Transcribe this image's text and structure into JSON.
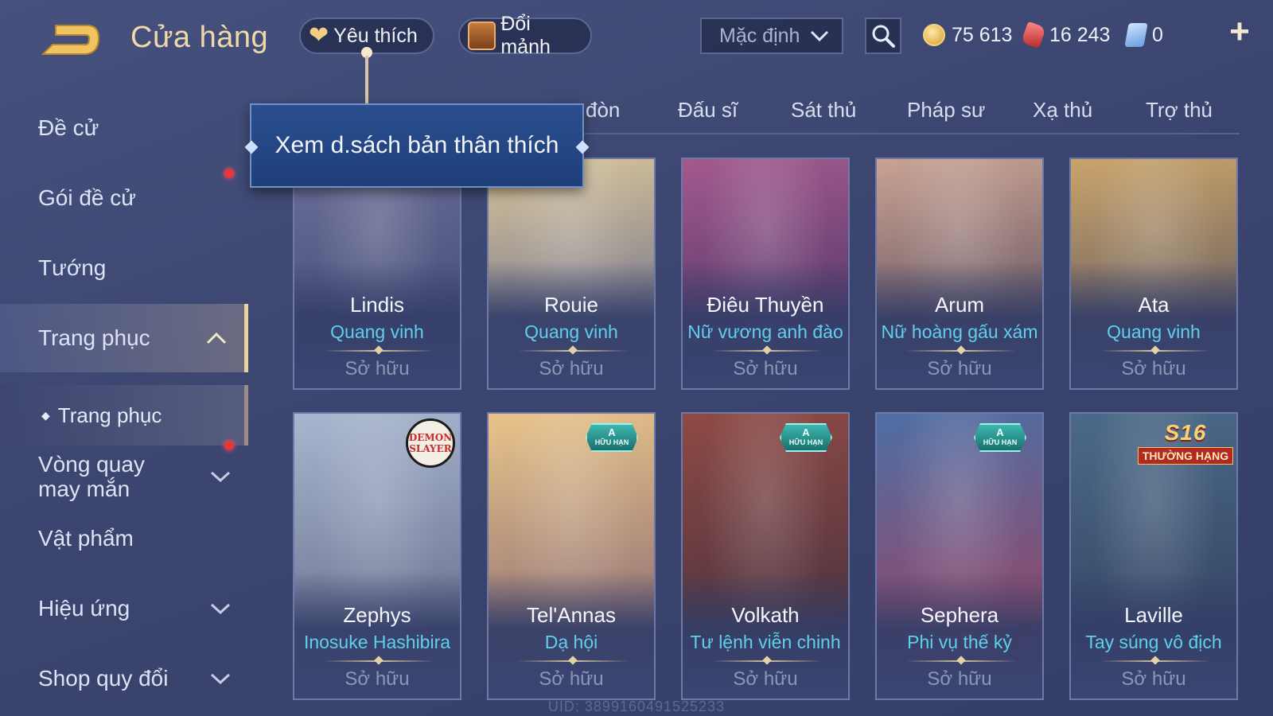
{
  "header": {
    "title": "Cửa hàng",
    "favorites_label": "Yêu thích",
    "fragments_label": "Đổi mảnh",
    "sort": {
      "selected": "Mặc định"
    },
    "currencies": {
      "gold": "75 613",
      "gems": "16 243",
      "vouchers": "0"
    }
  },
  "tooltip": {
    "text": "Xem d.sách bản thân thích"
  },
  "sidebar": {
    "items": [
      {
        "label": "Đề cử",
        "notify": false
      },
      {
        "label": "Gói đề cử",
        "notify": true
      },
      {
        "label": "Tướng",
        "notify": false
      },
      {
        "label": "Trang phục",
        "expanded": true
      },
      {
        "label": "Vòng quay may mắn",
        "notify": true
      },
      {
        "label": "Vật phẩm"
      },
      {
        "label": "Hiệu ứng"
      },
      {
        "label": "Shop quy đổi"
      }
    ],
    "sub_item": "Trang phục"
  },
  "tabs": [
    {
      "label": "đòn"
    },
    {
      "label": "Đấu sĩ"
    },
    {
      "label": "Sát thủ"
    },
    {
      "label": "Pháp sư"
    },
    {
      "label": "Xạ thủ"
    },
    {
      "label": "Trợ thủ"
    }
  ],
  "cards": [
    {
      "hero": "Lindis",
      "skin": "Quang vinh",
      "status": "Sở hữu",
      "colors": [
        "#6b6f98",
        "#3d4470"
      ]
    },
    {
      "hero": "Rouie",
      "skin": "Quang vinh",
      "status": "Sở hữu",
      "colors": [
        "#d8c59a",
        "#5a5f8a"
      ]
    },
    {
      "hero": "Điêu Thuyền",
      "skin": "Nữ vương anh đào",
      "status": "Sở hữu",
      "colors": [
        "#a35a8e",
        "#3e2c5e"
      ]
    },
    {
      "hero": "Arum",
      "skin": "Nữ hoàng gấu xám",
      "status": "Sở hữu",
      "colors": [
        "#c9a394",
        "#4a3e52"
      ]
    },
    {
      "hero": "Ata",
      "skin": "Quang vinh",
      "status": "Sở hữu",
      "colors": [
        "#c9a46a",
        "#4e4a5e"
      ]
    },
    {
      "hero": "Zephys",
      "skin": "Inosuke Hashibira",
      "status": "Sở hữu",
      "badge": "demon-slayer",
      "badge_text": [
        "DEMON",
        "SLAYER"
      ],
      "colors": [
        "#a8b6cf",
        "#5a5f7e"
      ]
    },
    {
      "hero": "Tel'Annas",
      "skin": "Dạ hội",
      "status": "Sở hữu",
      "badge": "limited",
      "badge_tier": "A",
      "badge_text": "HỮU HẠN",
      "colors": [
        "#e8c48a",
        "#7a5a6e"
      ]
    },
    {
      "hero": "Volkath",
      "skin": "Tư lệnh viễn chinh",
      "status": "Sở hữu",
      "badge": "limited",
      "badge_tier": "A",
      "badge_text": "HỮU HẠN",
      "colors": [
        "#8e4a45",
        "#3a2c3e"
      ]
    },
    {
      "hero": "Sephera",
      "skin": "Phi vụ thế kỷ",
      "status": "Sở hữu",
      "badge": "limited",
      "badge_tier": "A",
      "badge_text": "HỮU HẠN",
      "colors": [
        "#4d6ea4",
        "#a83c58"
      ]
    },
    {
      "hero": "Laville",
      "skin": "Tay súng vô địch",
      "status": "Sở hữu",
      "badge": "s16",
      "badge_title": "S16",
      "badge_text": "THƯỜNG HẠNG",
      "colors": [
        "#4b6a88",
        "#2e3b5a"
      ]
    }
  ],
  "footer": {
    "uid": "UID: 3899160491525233"
  },
  "colors": {
    "accent_gold": "#efd9a8",
    "skin_name": "#5fd0ea",
    "notify_dot": "#e4363f"
  }
}
